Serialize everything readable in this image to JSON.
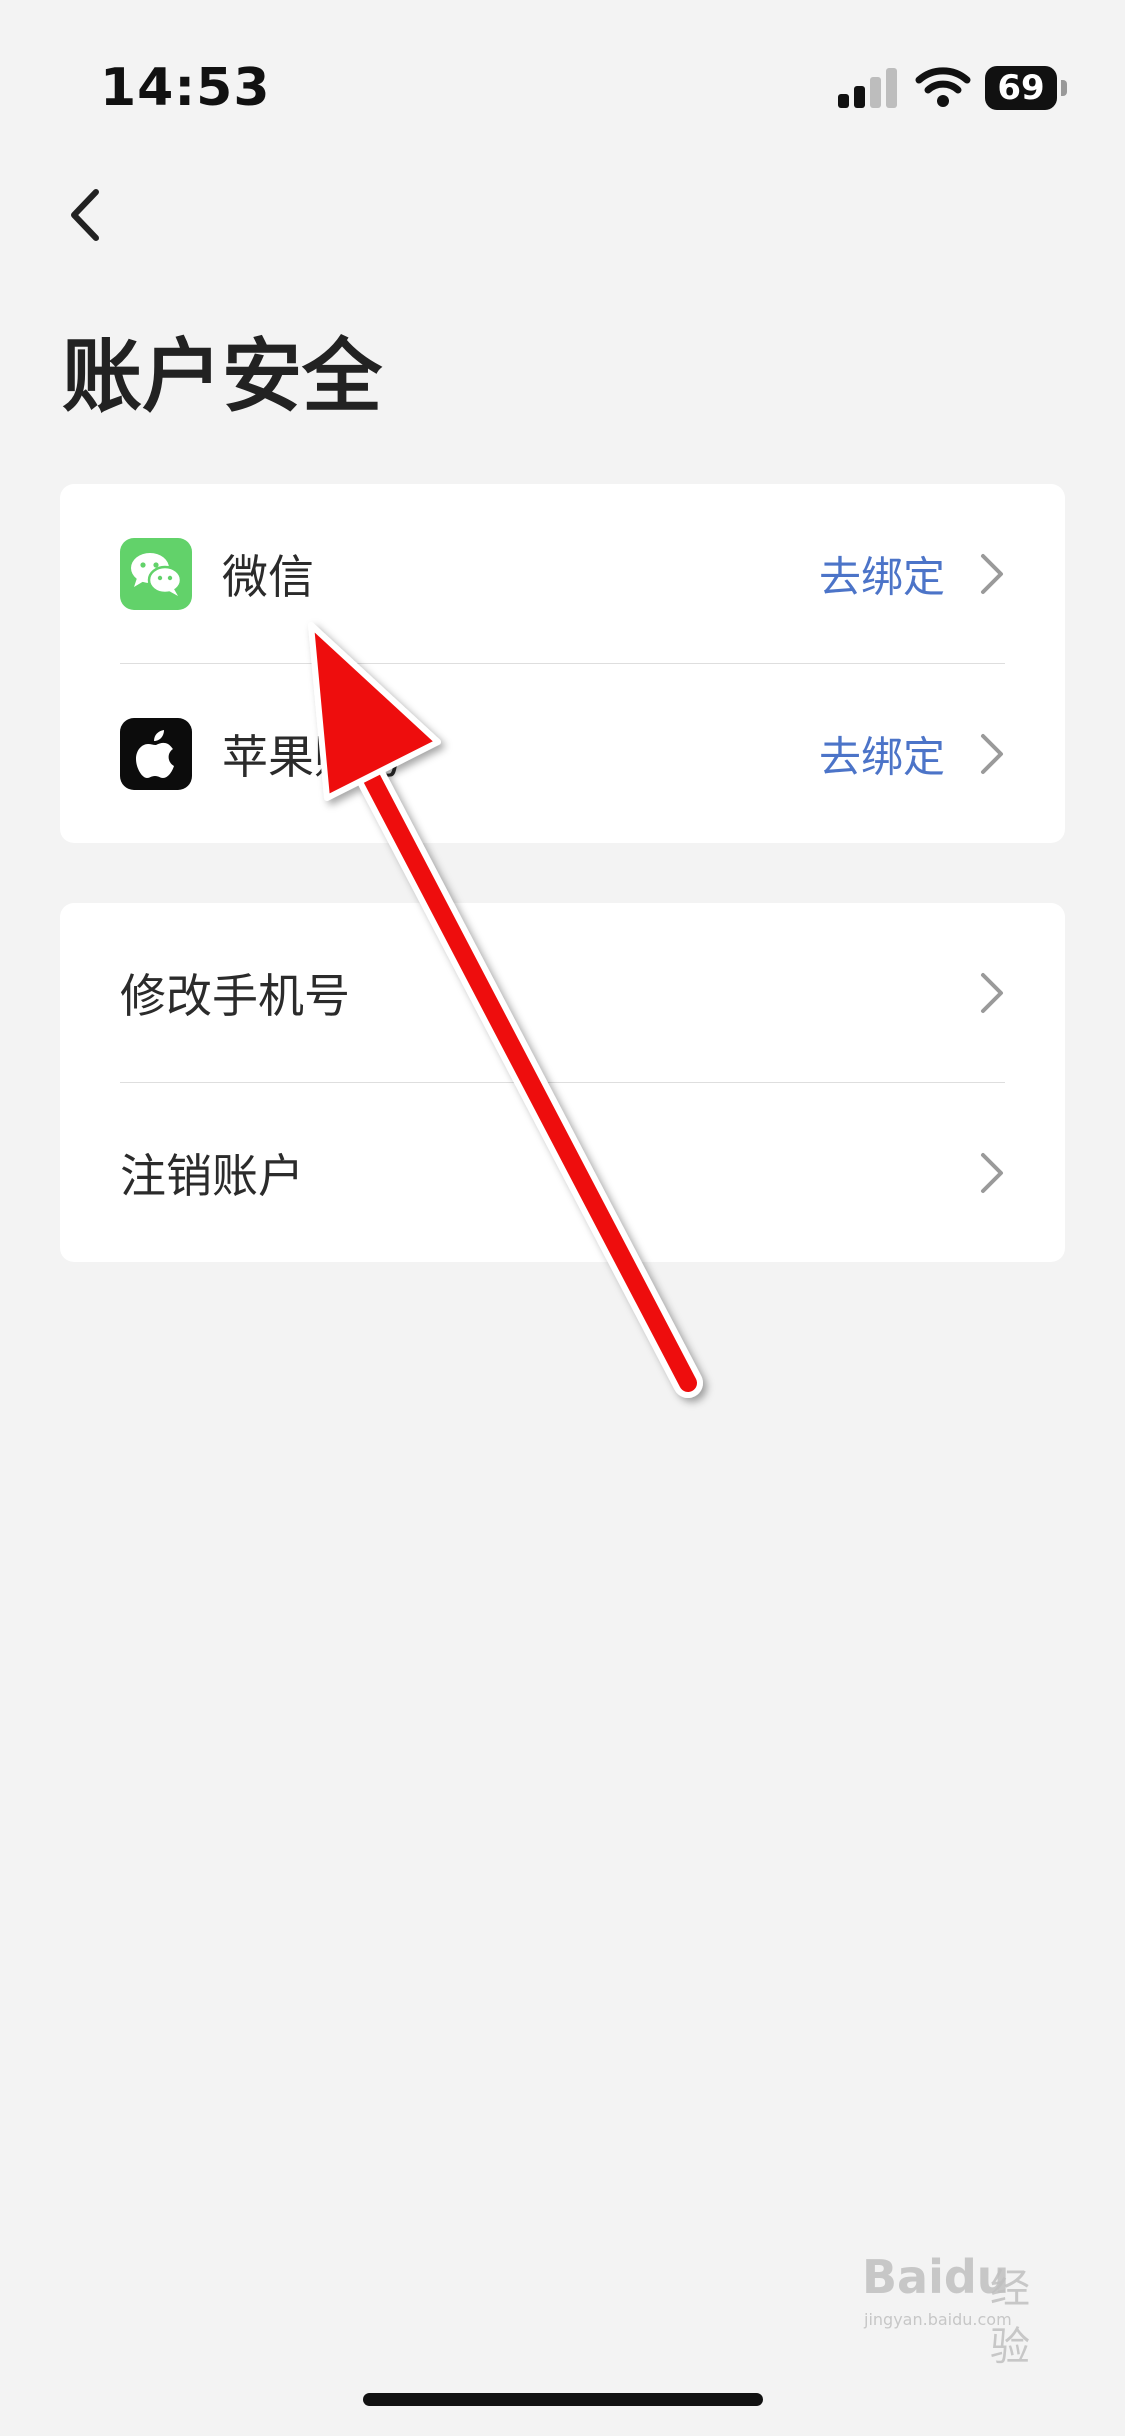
{
  "status_bar": {
    "time": "14:53",
    "battery_level": "69"
  },
  "header": {
    "back_icon": "chevron-left-icon",
    "title": "账户安全"
  },
  "bindings_card": {
    "items": [
      {
        "icon": "wechat-icon",
        "label": "微信",
        "action": "去绑定"
      },
      {
        "icon": "apple-icon",
        "label": "苹果账号",
        "action": "去绑定"
      }
    ]
  },
  "account_card": {
    "items": [
      {
        "label": "修改手机号"
      },
      {
        "label": "注销账户"
      }
    ]
  },
  "colors": {
    "background": "#f3f3f3",
    "card": "#ffffff",
    "action_link": "#4c74c8",
    "wechat_green": "#62d26a",
    "annotation_arrow": "#ee1111"
  },
  "watermark": {
    "logo": "Baidu",
    "text": "经验",
    "url": "jingyan.baidu.com"
  }
}
